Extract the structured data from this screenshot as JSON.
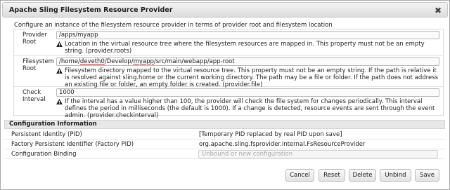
{
  "dialog": {
    "title": "Apache Sling Filesystem Resource Provider",
    "close_glyph": "✖",
    "description": "Configure an instance of the filesystem resource provider in terms of provider root and filesystem location"
  },
  "properties": [
    {
      "label": "Provider Root",
      "value": "/apps/myapp",
      "description": "Location in the virtual resource tree where the filesystem resources are mapped in. This property must not be an empty string. (provider.roots)"
    },
    {
      "label": "Filesystem Root",
      "value_parts": [
        "/home/",
        "deveth0",
        "/Develop/",
        "myapp",
        "/src/main/webapp/app-root"
      ],
      "description": "Filesystem directory mapped to the virtual resource tree. This property must not be an empty string. If the path is relative it is resolved against sling.home or the current working directory. The path may be a file or folder. If the path does not address an existing file or folder, an empty folder is created. (provider.file)"
    },
    {
      "label": "Check Interval",
      "value": "1000",
      "description": "If the interval has a value higher than 100, the provider will check the file system for changes periodically. This interval defines the period in milliseconds (the default is 1000). If a change is detected, resource events are sent through the event admin. (provider.checkinterval)"
    }
  ],
  "config_info": {
    "heading": "Configuration Information",
    "rows": [
      {
        "label": "Persistent Identity (PID)",
        "value": "[Temporary PID replaced by real PID upon save]"
      },
      {
        "label": "Factory Persistent Identifier (Factory PID)",
        "value": "org.apache.sling.fsprovider.internal.FsResourceProvider"
      },
      {
        "label": "Configuration Binding",
        "placeholder": "Unbound or new configuration"
      }
    ]
  },
  "buttons": {
    "cancel": "Cancel",
    "reset": "Reset",
    "delete": "Delete",
    "unbind": "Unbind",
    "save": "Save"
  },
  "icons": {
    "warning": "warning-icon",
    "close": "close-icon"
  },
  "colors": {
    "title_bg": "#dcdcdc",
    "warning_fill": "#222222",
    "spell_underline": "#cc2222"
  }
}
